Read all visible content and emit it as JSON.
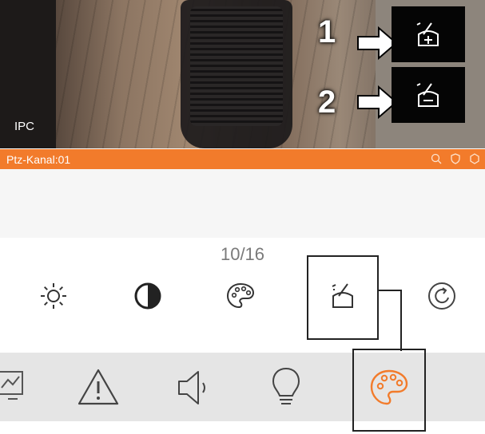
{
  "video": {
    "camera_label": "IPC",
    "callout_1": "1",
    "callout_2": "2",
    "zoom_in_tile_icon": "image-adjust-plus-icon",
    "zoom_out_tile_icon": "image-adjust-minus-icon"
  },
  "channel_bar": {
    "label": "Ptz-Kanal:01",
    "color": "#f27b2b",
    "icons": [
      "zoom-icon",
      "shield-icon",
      "settings-icon"
    ]
  },
  "functions": {
    "page_indicator": "10/16",
    "items": [
      {
        "name": "brightness-icon"
      },
      {
        "name": "contrast-icon"
      },
      {
        "name": "saturation-palette-icon"
      },
      {
        "name": "image-adjust-icon",
        "highlighted": true
      },
      {
        "name": "reset-icon"
      }
    ]
  },
  "toolbar": {
    "items": [
      {
        "name": "chart-icon"
      },
      {
        "name": "alarm-warning-icon"
      },
      {
        "name": "speaker-icon"
      },
      {
        "name": "light-bulb-icon"
      },
      {
        "name": "color-palette-icon",
        "active": true
      }
    ],
    "active_color": "#f27b2b"
  }
}
